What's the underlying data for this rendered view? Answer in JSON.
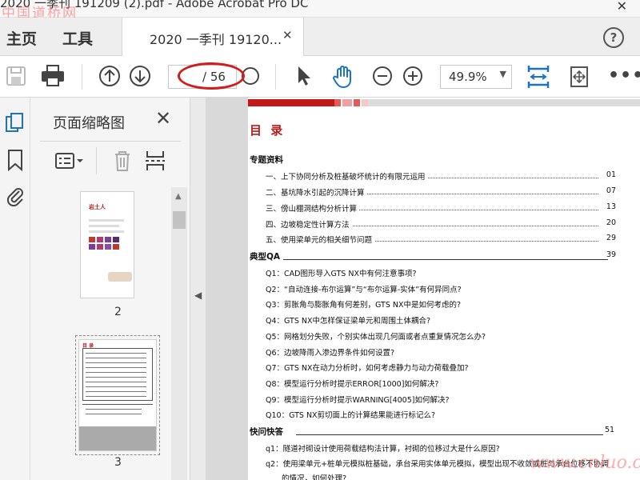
{
  "window": {
    "title": "2020 一季刊 191209 (2).pdf - Adobe Acrobat Pro DC",
    "watermark_top": "中国道桥网",
    "watermark_bottom": "www.cnluo.com"
  },
  "menu": {
    "home_label": "主页",
    "tools_label": "工具",
    "tab_label": "2020 一季刊 19120...",
    "help_label": "?"
  },
  "toolbar": {
    "page_current": "",
    "page_total": "/ 56",
    "zoom_value": "49.9%"
  },
  "thumbnails_panel": {
    "title": "页面缩略图",
    "thumbs": [
      {
        "page_label": "2",
        "thumb_title": "岩土人"
      },
      {
        "page_label": "3",
        "thumb_title": "目 录"
      }
    ]
  },
  "document": {
    "toc_title": "目  录",
    "sections": [
      {
        "title": "专题资料",
        "page": "",
        "items": [
          {
            "text": "一、上下协同分析及桩基破坏统计的有限元运用",
            "page": "01"
          },
          {
            "text": "二、基坑降水引起的沉降计算",
            "page": "07"
          },
          {
            "text": "三、傍山棚洞结构分析计算",
            "page": "13"
          },
          {
            "text": "四、边坡稳定性计算方法",
            "page": "20"
          },
          {
            "text": "五、使用梁单元的相关细节问题",
            "page": "29"
          }
        ]
      },
      {
        "title": "典型QA",
        "page": "39",
        "items": [
          {
            "text": "Q1：CAD图形导入GTS NX中有何注意事项?"
          },
          {
            "text": "Q2：“自动连接-布尔运算”与“布尔运算-实体”有何异同点?"
          },
          {
            "text": "Q3：剪胀角与膨胀角有何差别，GTS NX中是如何考虑的?"
          },
          {
            "text": "Q4：GTS NX中怎样保证梁单元和周围土体耦合?"
          },
          {
            "text": "Q5：网格划分失败，个别实体出现几何面或者点重复情况怎么办?"
          },
          {
            "text": "Q6：边坡降雨入渗边界条件如何设置?"
          },
          {
            "text": "Q7：GTS NX在动力分析时，如何考虑静力与动力荷载叠加?"
          },
          {
            "text": "Q8：模型运行分析时提示ERROR[1000]如何解决?"
          },
          {
            "text": "Q9：模型运行分析时提示WARNING[4005]如何解决?"
          },
          {
            "text": "Q10：GTS NX剪切面上的计算结果能进行标记么?"
          }
        ]
      },
      {
        "title": "快问快答",
        "page": "51",
        "items": [
          {
            "text": "q1：隧道衬砌设计使用荷载结构法计算，衬砌的位移过大是什么原因?"
          },
          {
            "text": "q2：使用梁单元+桩单元模拟桩基础，承台采用实体单元模拟，模型出现不收敛或桩与承台位移不协调"
          },
          {
            "text": "的情况，如何处理?"
          }
        ]
      }
    ]
  },
  "colors": {
    "accent_blue": "#1a73c9",
    "toc_title_red": "#b21e1e",
    "annotation_red": "#d41a1a"
  }
}
